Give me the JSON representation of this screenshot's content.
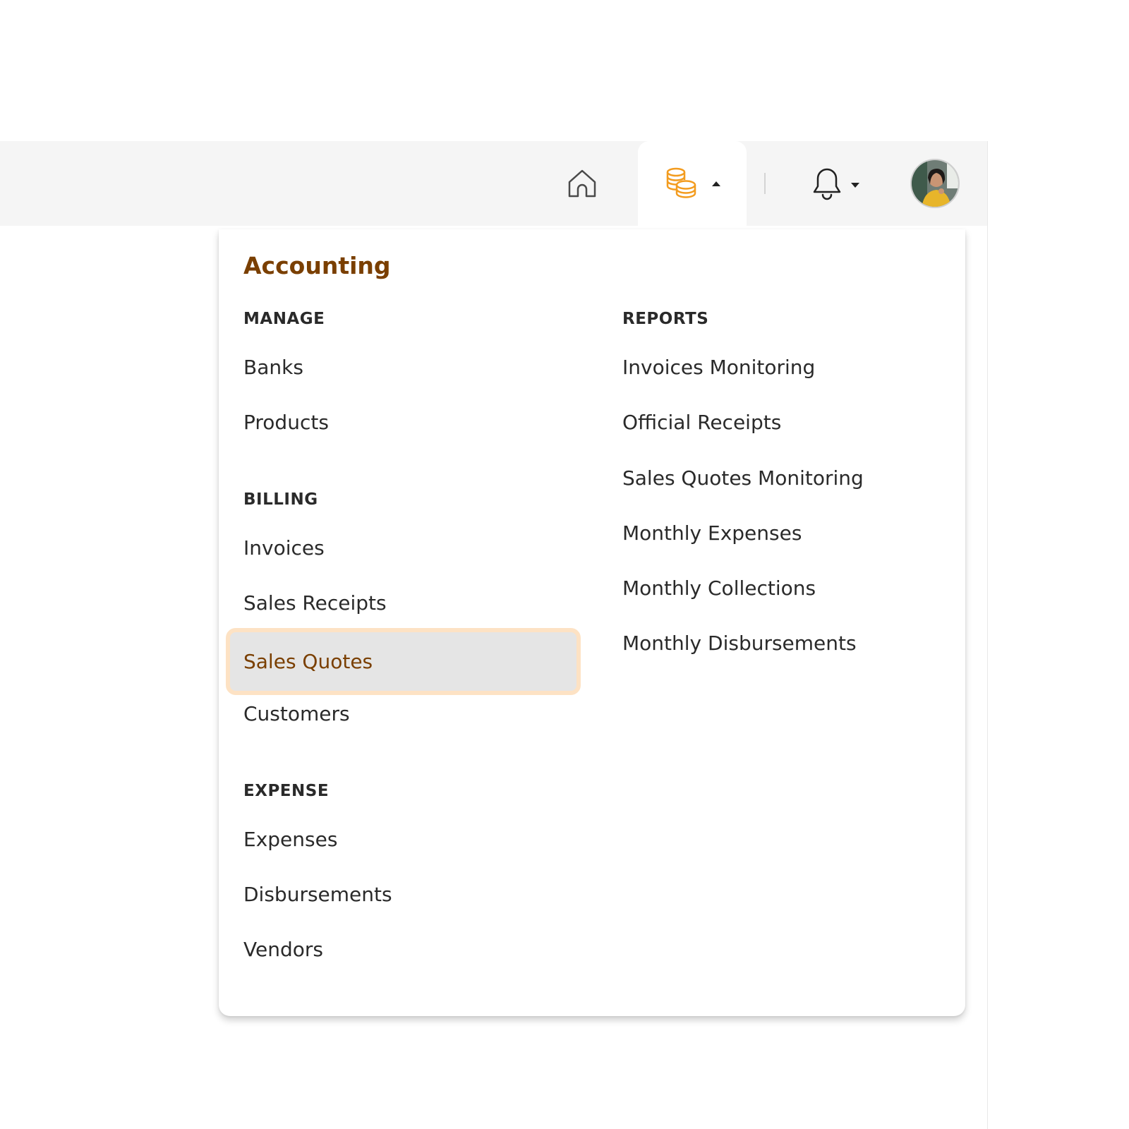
{
  "topbar": {
    "icons": {
      "home": "home-icon",
      "accounting": "coins-icon",
      "notifications": "bell-icon",
      "avatar": "user-avatar"
    },
    "accent_color": "#F39C1F"
  },
  "dropdown": {
    "title": "Accounting",
    "manage": {
      "heading": "MANAGE",
      "items": [
        "Banks",
        "Products"
      ]
    },
    "billing": {
      "heading": "BILLING",
      "items": [
        "Invoices",
        "Sales Receipts",
        "Sales Quotes",
        "Customers"
      ],
      "selected": "Sales Quotes"
    },
    "expense": {
      "heading": "EXPENSE",
      "items": [
        "Expenses",
        "Disbursements",
        "Vendors"
      ]
    },
    "reports": {
      "heading": "REPORTS",
      "items": [
        "Invoices Monitoring",
        "Official Receipts",
        "Sales Quotes Monitoring",
        "Monthly Expenses",
        "Monthly Collections",
        "Monthly Disbursements"
      ]
    }
  }
}
